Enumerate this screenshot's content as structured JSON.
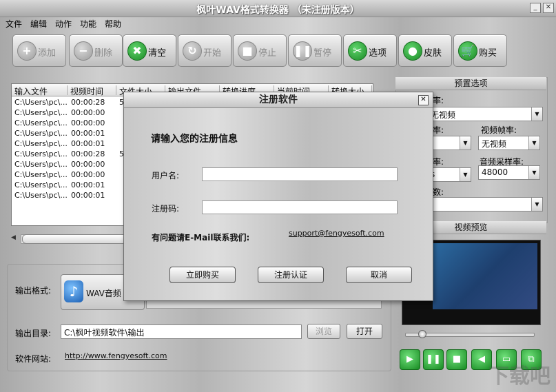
{
  "window": {
    "title": "枫叶WAV格式转换器  （未注册版本）"
  },
  "menu": [
    "文件",
    "编辑",
    "动作",
    "功能",
    "帮助"
  ],
  "toolbar": {
    "add": "添加",
    "delete": "删除",
    "clear": "清空",
    "start": "开始",
    "stop": "停止",
    "pause": "暂停",
    "options": "选项",
    "skin": "皮肤",
    "buy": "购买"
  },
  "filelist": {
    "headers": [
      "输入文件",
      "视频时间",
      "文件大小",
      "输出文件",
      "转换进度",
      "当前时间",
      "转换大小"
    ],
    "rows": [
      {
        "file": "C:\\Users\\pc\\...",
        "duration": "00:00:28",
        "size": "5"
      },
      {
        "file": "C:\\Users\\pc\\...",
        "duration": "00:00:00",
        "size": ""
      },
      {
        "file": "C:\\Users\\pc\\...",
        "duration": "00:00:00",
        "size": ""
      },
      {
        "file": "C:\\Users\\pc\\...",
        "duration": "00:00:01",
        "size": ""
      },
      {
        "file": "C:\\Users\\pc\\...",
        "duration": "00:00:01",
        "size": ""
      },
      {
        "file": "C:\\Users\\pc\\...",
        "duration": "00:00:28",
        "size": "5"
      },
      {
        "file": "C:\\Users\\pc\\...",
        "duration": "00:00:00",
        "size": ""
      },
      {
        "file": "C:\\Users\\pc\\...",
        "duration": "00:00:00",
        "size": ""
      },
      {
        "file": "C:\\Users\\pc\\...",
        "duration": "00:00:01",
        "size": ""
      },
      {
        "file": "C:\\Users\\pc\\...",
        "duration": "00:00:01",
        "size": ""
      }
    ]
  },
  "output": {
    "format_label": "输出格式:",
    "format_value": "WAV音频",
    "dir_label": "输出目录:",
    "dir_value": "C:\\枫叶视频软件\\输出",
    "browse": "浏览",
    "open": "打开",
    "site_label": "软件网站:",
    "site_url": "http://www.fengyesoft.com"
  },
  "presets": {
    "title": "预置选项",
    "video_codec_label": "率:",
    "video_codec_value": "无视频",
    "bitrate_label": "率:",
    "framerate_label": "视频帧率:",
    "framerate_value": "无视频",
    "audio_label": "率:",
    "audio_value": "s",
    "samplerate_label": "音频采样率:",
    "samplerate_value": "48000",
    "channels_label": "数:"
  },
  "preview": {
    "title": "视频预览"
  },
  "dialog": {
    "title": "注册软件",
    "heading": "请输入您的注册信息",
    "username_label": "用户名:",
    "username_value": "",
    "code_label": "注册码:",
    "code_value": "",
    "contact_label": "有问题请E-Mail联系我们:",
    "email": "support@fengyesoft.com",
    "buy_btn": "立即购买",
    "register_btn": "注册认证",
    "cancel_btn": "取消"
  },
  "watermark": "下载吧"
}
